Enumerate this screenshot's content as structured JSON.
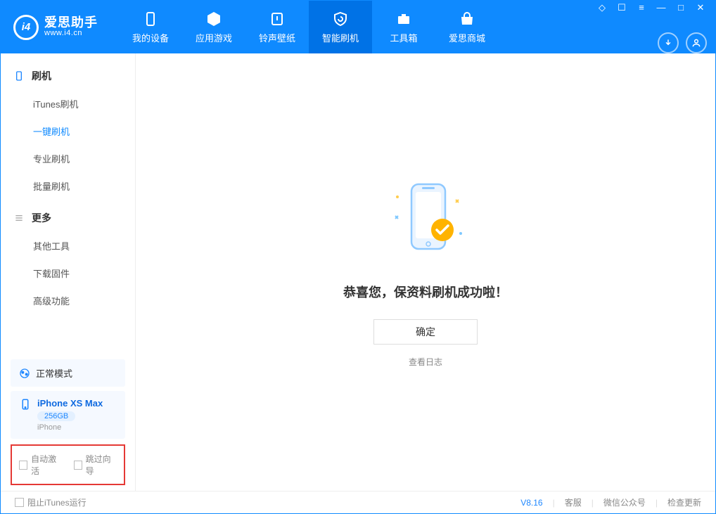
{
  "app": {
    "name": "爱思助手",
    "url": "www.i4.cn"
  },
  "nav": {
    "items": [
      {
        "label": "我的设备"
      },
      {
        "label": "应用游戏"
      },
      {
        "label": "铃声壁纸"
      },
      {
        "label": "智能刷机"
      },
      {
        "label": "工具箱"
      },
      {
        "label": "爱思商城"
      }
    ]
  },
  "sidebar": {
    "section1": {
      "title": "刷机",
      "items": [
        "iTunes刷机",
        "一键刷机",
        "专业刷机",
        "批量刷机"
      ]
    },
    "section2": {
      "title": "更多",
      "items": [
        "其他工具",
        "下载固件",
        "高级功能"
      ]
    },
    "mode_card": "正常模式",
    "device": {
      "name": "iPhone XS Max",
      "capacity": "256GB",
      "type": "iPhone"
    },
    "options": {
      "auto_activate": "自动激活",
      "skip_guide": "跳过向导"
    }
  },
  "main": {
    "success": "恭喜您，保资料刷机成功啦！",
    "ok": "确定",
    "view_log": "查看日志"
  },
  "footer": {
    "block_itunes": "阻止iTunes运行",
    "version": "V8.16",
    "support": "客服",
    "wechat": "微信公众号",
    "update": "检查更新"
  }
}
